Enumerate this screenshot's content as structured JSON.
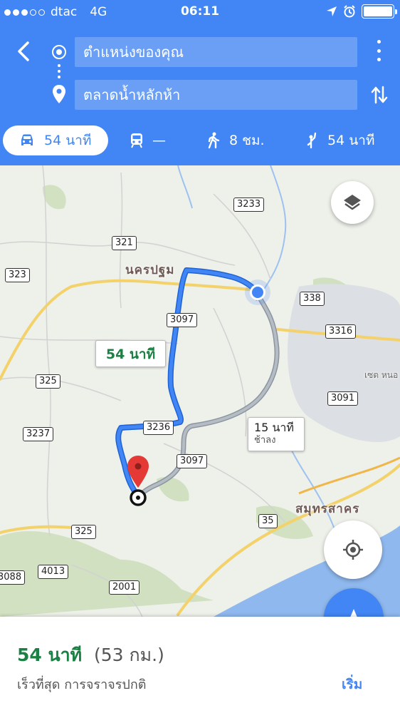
{
  "status_bar": {
    "carrier": "dtac",
    "network": "4G",
    "time": "06:11",
    "icons": [
      "signal-dots",
      "location-arrow-icon",
      "alarm-icon",
      "battery-icon"
    ],
    "battery_level": 1.0
  },
  "header": {
    "origin": "ตำแหน่งของคุณ",
    "destination": "ตลาดน้ำหลักห้า",
    "icons": {
      "back": "back-arrow-icon",
      "origin": "origin-circle-icon",
      "destination": "destination-pin-icon",
      "more": "more-vert-icon",
      "swap": "swap-vertical-icon"
    },
    "modes": [
      {
        "name": "drive",
        "icon": "car-icon",
        "label": "54 นาที",
        "active": true
      },
      {
        "name": "transit",
        "icon": "train-icon",
        "label": "—",
        "active": false
      },
      {
        "name": "walk",
        "icon": "walk-icon",
        "label": "8 ชม.",
        "active": false
      },
      {
        "name": "ride",
        "icon": "hail-icon",
        "label": "54 นาที",
        "active": false
      }
    ],
    "color": "#4285f4"
  },
  "map": {
    "places": [
      "นครปฐม",
      "สมุทรสาคร",
      "เซต หนอ"
    ],
    "road_shields": [
      "3233",
      "321",
      "323",
      "338",
      "3316",
      "3097",
      "325",
      "3091",
      "3237",
      "3236",
      "3097",
      "35",
      "325",
      "4013",
      "3088",
      "2001"
    ],
    "route_main_label": "54 นาที",
    "route_alt_label": "15 นาที",
    "route_alt_sub": "ช้าลง",
    "route_color": "#4285f4",
    "alt_route_color": "#9aa3ab",
    "sea_color": "#8fb8ee"
  },
  "sheet": {
    "duration": "54 นาที",
    "distance": "(53 กม.)",
    "subtitle": "เร็วที่สุด การจราจรปกติ",
    "start": "เริ่ม"
  }
}
